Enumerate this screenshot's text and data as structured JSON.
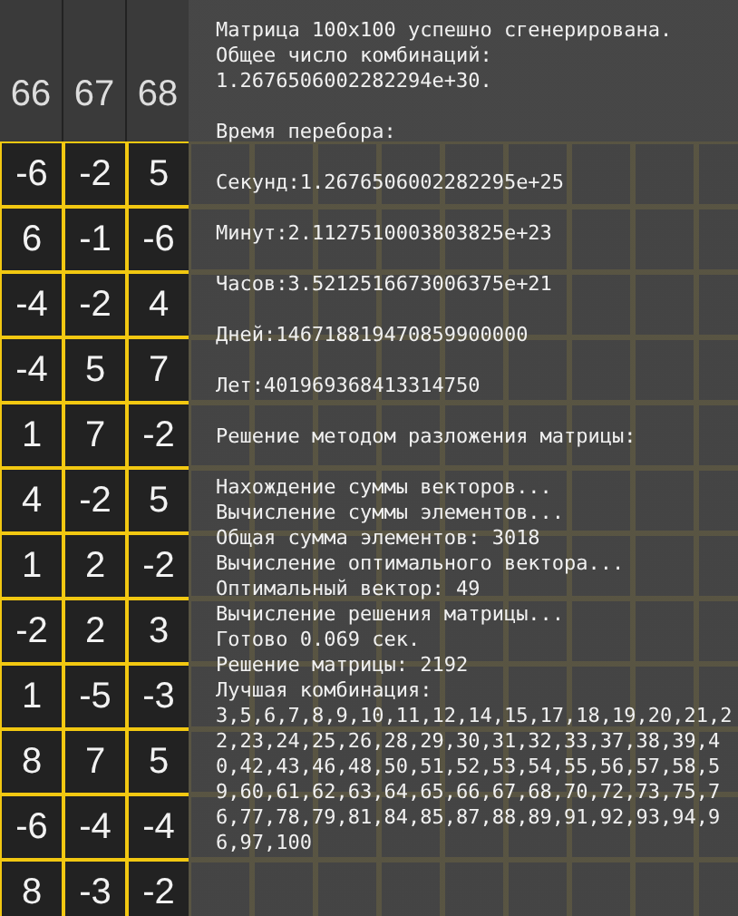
{
  "matrix": {
    "column_headers": [
      "66",
      "67",
      "68"
    ],
    "rows": [
      [
        "-6",
        "-2",
        "5"
      ],
      [
        "6",
        "-1",
        "-6"
      ],
      [
        "-4",
        "-2",
        "4"
      ],
      [
        "-4",
        "5",
        "7"
      ],
      [
        "1",
        "7",
        "-2"
      ],
      [
        "4",
        "-2",
        "5"
      ],
      [
        "1",
        "2",
        "-2"
      ],
      [
        "-2",
        "2",
        "3"
      ],
      [
        "1",
        "-5",
        "-3"
      ],
      [
        "8",
        "7",
        "5"
      ],
      [
        "-6",
        "-4",
        "-4"
      ],
      [
        "8",
        "-3",
        "-2"
      ]
    ]
  },
  "log": {
    "blocks": [
      [
        "Матрица 100x100 успешно сгенерирована.",
        "Общее число комбинаций:",
        "1.2676506002282294e+30."
      ],
      [
        "Время перебора:"
      ],
      [
        "Секунд:1.2676506002282295e+25"
      ],
      [
        "Минут:2.1127510003803825e+23"
      ],
      [
        "Часов:3.5212516673006375e+21"
      ],
      [
        "Дней:146718819470859900000"
      ],
      [
        "Лет:401969368413314750"
      ],
      [
        "Решение методом разложения матрицы:"
      ],
      [
        "Нахождение суммы векторов...",
        "Вычисление суммы элементов...",
        "Общая сумма элементов: 3018",
        "Вычисление оптимального вектора...",
        "Оптимальный вектор: 49",
        "Вычисление решения матрицы...",
        "Готово 0.069 сек.",
        "Решение матрицы: 2192",
        "Лучшая комбинация:",
        "3,5,6,7,8,9,10,11,12,14,15,17,18,19,20,21,22,23,24,25,26,28,29,30,31,32,33,37,38,39,40,42,43,46,48,50,51,52,53,54,55,56,57,58,59,60,61,62,63,64,65,66,67,68,70,72,73,75,76,77,78,79,81,84,85,87,88,89,91,92,93,94,96,97,100"
      ]
    ]
  }
}
